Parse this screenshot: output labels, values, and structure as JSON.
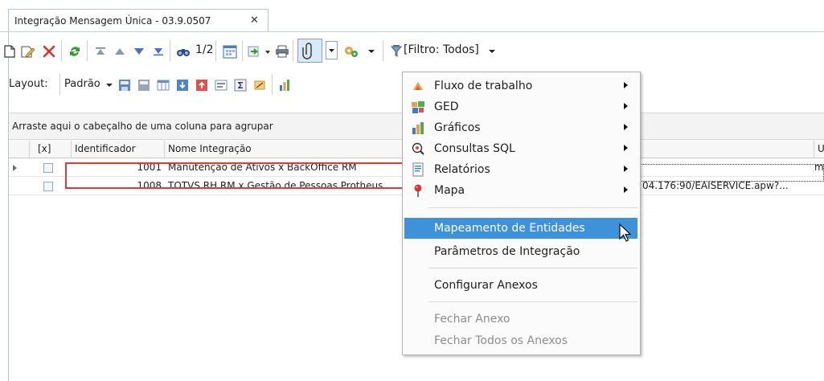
{
  "tab": {
    "title": "Integração Mensagem Única - 03.9.0507",
    "close": "✕"
  },
  "toolbar1": {
    "page_label": "1/2",
    "filter_label": "[Filtro: Todos]"
  },
  "toolbar2": {
    "layout_label": "Layout:",
    "layout_value": "Padrão"
  },
  "groupbar": {
    "hint": "Arraste aqui o cabeçalho de uma coluna para agrupar"
  },
  "grid": {
    "columns": [
      "[x]",
      "Identificador",
      "Nome Integração",
      "U"
    ],
    "rows": [
      {
        "id": "1001",
        "name": "Manutenção de Ativos x BackOffice RM",
        "url": "",
        "extra": "m"
      },
      {
        "id": "1008",
        "name": "TOTVS RH RM x Gestão de Pessoas Protheus",
        "url": "04.176:90/EAISERVICE.apw?...",
        "extra": ""
      }
    ]
  },
  "menu": {
    "items": [
      {
        "label": "Fluxo de trabalho",
        "icon": "workflow-icon",
        "submenu": true
      },
      {
        "label": "GED",
        "icon": "ged-icon",
        "submenu": true
      },
      {
        "label": "Gráficos",
        "icon": "chart-icon",
        "submenu": true
      },
      {
        "label": "Consultas SQL",
        "icon": "sql-query-icon",
        "submenu": true
      },
      {
        "label": "Relatórios",
        "icon": "report-icon",
        "submenu": true
      },
      {
        "label": "Mapa",
        "icon": "map-pin-icon",
        "submenu": true
      },
      {
        "label": "Mapeamento de Entidades",
        "selected": true
      },
      {
        "label": "Parâmetros de Integração"
      },
      {
        "label": "Configurar Anexos"
      },
      {
        "label": "Fechar Anexo",
        "disabled": true
      },
      {
        "label": "Fechar Todos os Anexos",
        "disabled": true
      }
    ]
  },
  "colors": {
    "accent": "#3e92d9",
    "highlight_border": "#e4383a"
  }
}
